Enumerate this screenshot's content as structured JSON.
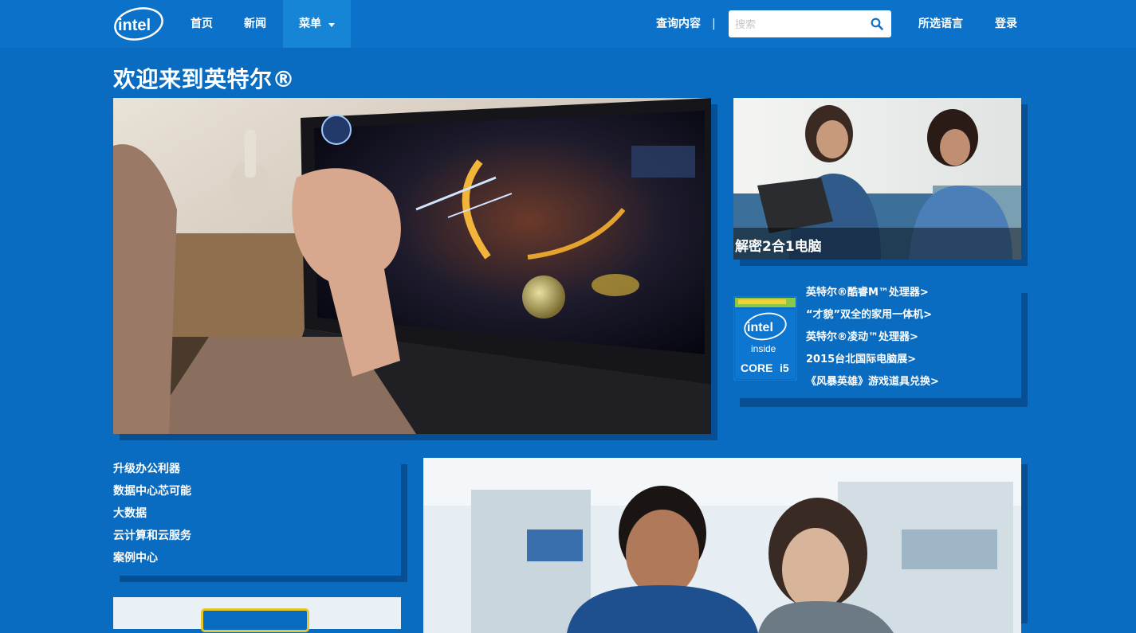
{
  "header": {
    "logo_text": "intel",
    "nav": [
      {
        "label": "首页"
      },
      {
        "label": "新闻"
      },
      {
        "label": "菜单"
      }
    ],
    "query_label": "查询内容",
    "separator": "|",
    "search": {
      "placeholder": "搜索",
      "value": ""
    },
    "language_label": "所选语言",
    "login_label": "登录"
  },
  "page_title": "欢迎来到英特尔®",
  "promo": {
    "caption": "解密2合1电脑"
  },
  "chip_badge": {
    "brand": "intel",
    "line1": "inside",
    "line2": "CORE",
    "line3": "i5"
  },
  "featured_links": [
    {
      "label": "英特尔®酷睿M™处理器>"
    },
    {
      "label": "“才貌”双全的家用一体机>"
    },
    {
      "label": "英特尔®凌动™处理器>"
    },
    {
      "label": "2015台北国际电脑展>"
    },
    {
      "label": "《风暴英雄》游戏道具兑换>"
    }
  ],
  "side_links": [
    {
      "label": "升级办公利器"
    },
    {
      "label": "数据中心芯可能"
    },
    {
      "label": "大数据"
    },
    {
      "label": "云计算和云服务"
    },
    {
      "label": "案例中心"
    }
  ],
  "colors": {
    "background": "#0a6cc0",
    "header": "#0b71c9",
    "menu_active": "#1685d6",
    "card_shadow": "#074f94",
    "accent_yellow": "#e8c52a"
  }
}
